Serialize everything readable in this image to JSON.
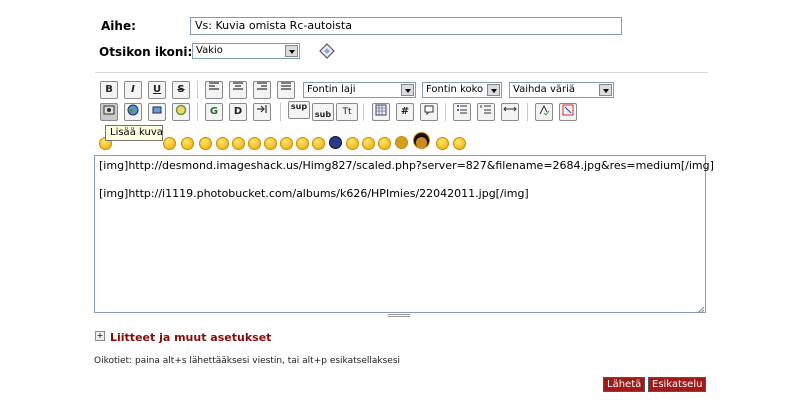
{
  "form": {
    "subject_label": "Aihe:",
    "subject_value": "Vs: Kuvia omista Rc-autoista",
    "icon_label": "Otsikon ikoni:",
    "icon_value": "Vakio"
  },
  "toolbar": {
    "row1": [
      "B",
      "I",
      "U",
      "S"
    ],
    "font_select": "Fontin laji",
    "size_select": "Fontin koko",
    "color_select": "Vaihda väriä",
    "row2_text": [
      "G",
      "D",
      "sup",
      "sub",
      "Tt",
      "#"
    ],
    "tooltip": "Lisää kuva"
  },
  "editor": {
    "line1": "[img]http://desmond.imageshack.us/Himg827/scaled.php?server=827&filename=2684.jpg&res=medium[/img]",
    "line2": "[img]http://i1119.photobucket.com/albums/k626/HPImies/22042011.jpg[/img]"
  },
  "attachments_label": "Liitteet ja muut asetukset",
  "shortcuts_hint": "Oikotiet: paina alt+s lähettääksesi viestin, tai alt+p esikatsellaksesi",
  "buttons": {
    "submit": "Lähetä",
    "preview": "Esikatselu"
  },
  "colors": {
    "button_bg": "#a11a1a",
    "link": "#8a0a0a"
  }
}
